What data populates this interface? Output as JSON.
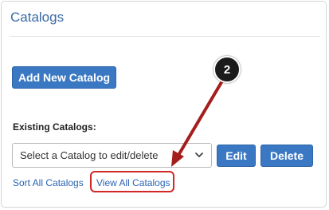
{
  "panel": {
    "title": "Catalogs"
  },
  "actions": {
    "add_new_label": "Add New Catalog"
  },
  "existing": {
    "label": "Existing Catalogs:",
    "select_value": "Select a Catalog to edit/delete",
    "edit_label": "Edit",
    "delete_label": "Delete"
  },
  "links": {
    "sort_all": "Sort All Catalogs",
    "view_all": "View All Catalogs"
  },
  "annotation": {
    "step_number": "2",
    "color": "#d22828"
  },
  "colors": {
    "title": "#3a6aa8",
    "button": "#3a78c4",
    "link": "#2a63b5"
  },
  "icons": {
    "select_arrow": "chevron-down-icon"
  }
}
